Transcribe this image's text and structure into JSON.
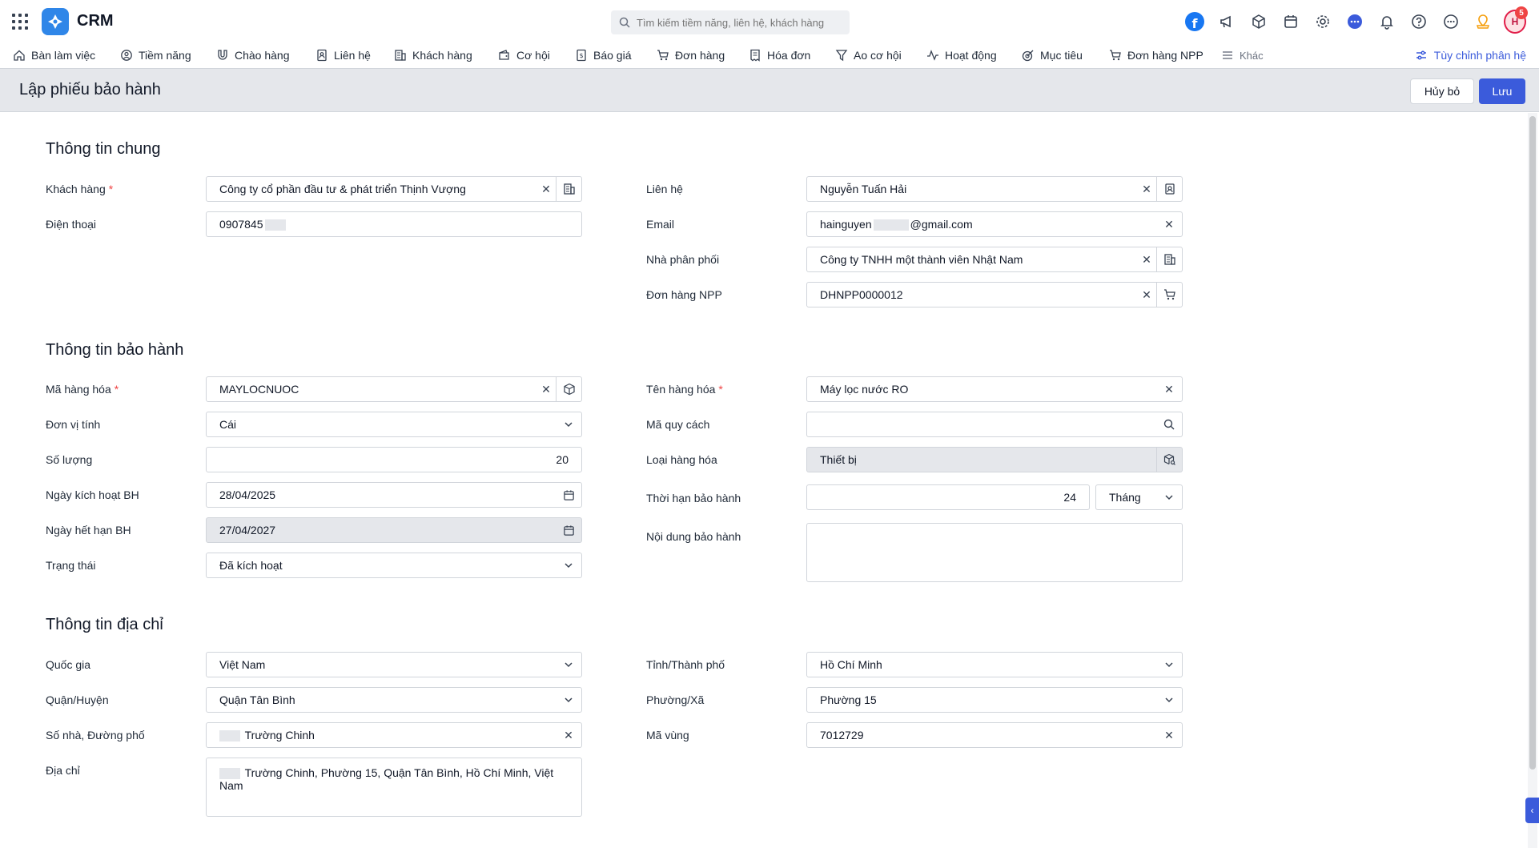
{
  "app": {
    "name": "CRM"
  },
  "search": {
    "placeholder": "Tìm kiếm tiềm năng, liên hệ, khách hàng"
  },
  "header": {
    "avatar_initials": "H",
    "notification_count": "5"
  },
  "nav": {
    "items": [
      {
        "label": "Bàn làm việc",
        "icon": "home-icon"
      },
      {
        "label": "Tiềm năng",
        "icon": "user-circle-icon"
      },
      {
        "label": "Chào hàng",
        "icon": "magnet-icon"
      },
      {
        "label": "Liên hệ",
        "icon": "contact-icon"
      },
      {
        "label": "Khách hàng",
        "icon": "building-icon"
      },
      {
        "label": "Cơ hội",
        "icon": "wallet-icon"
      },
      {
        "label": "Báo giá",
        "icon": "quote-icon"
      },
      {
        "label": "Đơn hàng",
        "icon": "cart-icon"
      },
      {
        "label": "Hóa đơn",
        "icon": "invoice-icon"
      },
      {
        "label": "Ao cơ hội",
        "icon": "funnel-icon"
      },
      {
        "label": "Hoạt động",
        "icon": "activity-icon"
      },
      {
        "label": "Mục tiêu",
        "icon": "target-icon"
      },
      {
        "label": "Đơn hàng NPP",
        "icon": "cart-npp-icon"
      },
      {
        "label": "Khác",
        "icon": "menu-icon"
      }
    ],
    "customize_label": "Tùy chỉnh phân hệ"
  },
  "page": {
    "title": "Lập phiếu bảo hành",
    "cancel_label": "Hủy bỏ",
    "save_label": "Lưu"
  },
  "general": {
    "title": "Thông tin chung",
    "customer": {
      "label": "Khách hàng",
      "value": "Công ty cổ phần đầu tư & phát triển Thịnh Vượng"
    },
    "phone": {
      "label": "Điện thoại",
      "value": "0907845"
    },
    "contact": {
      "label": "Liên hệ",
      "value": "Nguyễn Tuấn Hải"
    },
    "email": {
      "label": "Email",
      "value_prefix": "hainguyen",
      "value_suffix": "@gmail.com"
    },
    "distributor": {
      "label": "Nhà phân phối",
      "value": "Công ty TNHH một thành viên Nhật Nam"
    },
    "npp_order": {
      "label": "Đơn hàng NPP",
      "value": "DHNPP0000012"
    }
  },
  "warranty": {
    "title": "Thông tin bảo hành",
    "product_code": {
      "label": "Mã hàng hóa",
      "value": "MAYLOCNUOC"
    },
    "unit": {
      "label": "Đơn vị tính",
      "value": "Cái"
    },
    "quantity": {
      "label": "Số lượng",
      "value": "20"
    },
    "activation_date": {
      "label": "Ngày kích hoạt BH",
      "value": "28/04/2025"
    },
    "expiry_date": {
      "label": "Ngày hết hạn BH",
      "value": "27/04/2027"
    },
    "status": {
      "label": "Trạng thái",
      "value": "Đã kích hoạt"
    },
    "product_name": {
      "label": "Tên hàng hóa",
      "value": "Máy lọc nước RO"
    },
    "spec_code": {
      "label": "Mã quy cách",
      "value": ""
    },
    "product_type": {
      "label": "Loại hàng hóa",
      "value": "Thiết bị"
    },
    "period": {
      "label": "Thời hạn bảo hành",
      "value": "24",
      "unit": "Tháng"
    },
    "content": {
      "label": "Nội dung bảo hành",
      "value": ""
    }
  },
  "address": {
    "title": "Thông tin địa chỉ",
    "country": {
      "label": "Quốc gia",
      "value": "Việt Nam"
    },
    "district": {
      "label": "Quận/Huyện",
      "value": "Quận Tân Bình"
    },
    "street": {
      "label": "Số nhà, Đường phố",
      "value": "Trường Chinh"
    },
    "full": {
      "label": "Địa chỉ",
      "value": "Trường Chinh, Phường 15, Quận Tân Bình, Hồ Chí Minh, Việt Nam"
    },
    "province": {
      "label": "Tỉnh/Thành phố",
      "value": "Hồ Chí Minh"
    },
    "ward": {
      "label": "Phường/Xã",
      "value": "Phường 15"
    },
    "area_code": {
      "label": "Mã vùng",
      "value": "7012729"
    }
  }
}
